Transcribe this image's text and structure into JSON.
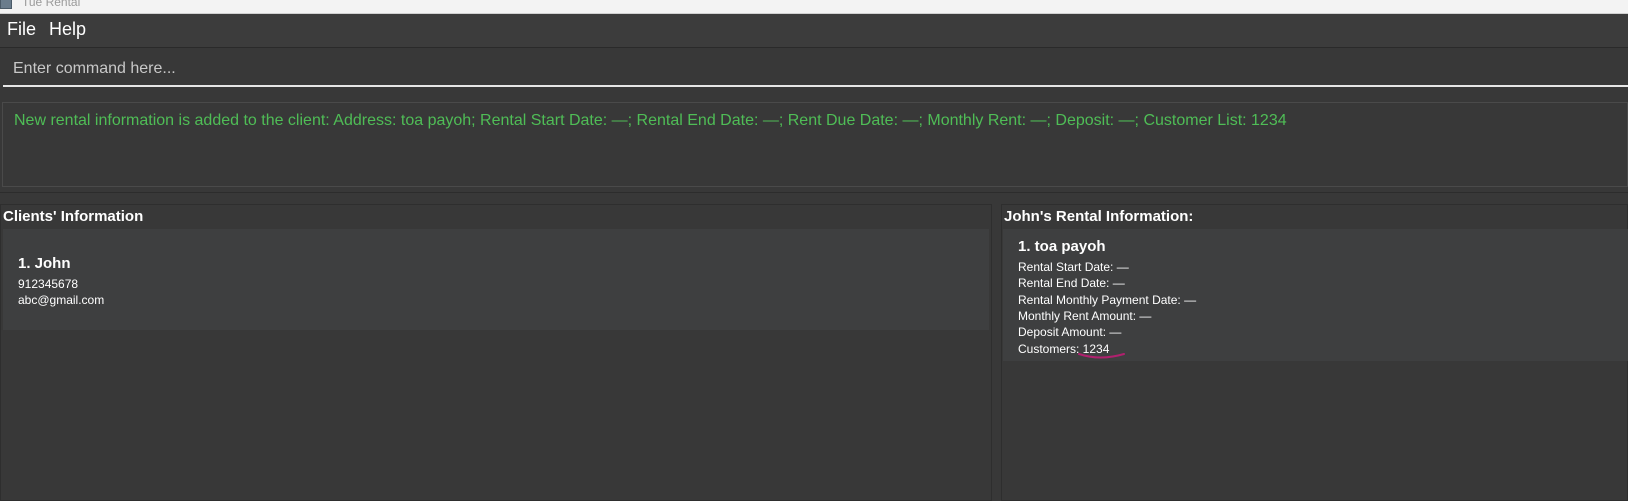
{
  "window": {
    "title": "Tue Rental"
  },
  "menu": {
    "file": "File",
    "help": "Help"
  },
  "command": {
    "placeholder": "Enter command here..."
  },
  "result": {
    "message": "New rental information is added to the client: Address: toa payoh; Rental Start Date: —; Rental End Date: —; Rent Due Date: —; Monthly Rent: —; Deposit: —; Customer List: 1234"
  },
  "clients_panel": {
    "header": "Clients' Information",
    "clients": [
      {
        "name": "1. John",
        "phone": "912345678",
        "email": "abc@gmail.com"
      }
    ]
  },
  "rental_panel": {
    "header": "John's Rental Information:",
    "rentals": [
      {
        "title": "1. toa payoh",
        "start_date": "Rental Start Date: —",
        "end_date": "Rental End Date: —",
        "payment_date": "Rental Monthly Payment Date: —",
        "monthly_rent": "Monthly Rent Amount: —",
        "deposit": "Deposit Amount: —",
        "customers": "Customers: 1234"
      }
    ]
  },
  "colors": {
    "background": "#383838",
    "result_text": "#4fbd56",
    "annotation_underline": "#b0206e"
  }
}
